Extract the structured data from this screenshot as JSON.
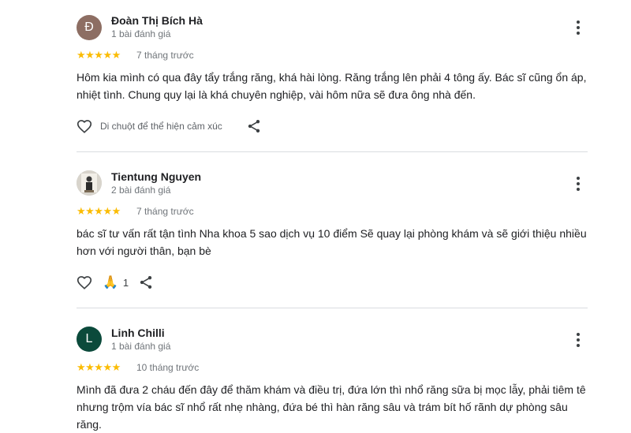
{
  "reviews": [
    {
      "avatar_letter": "Đ",
      "avatar_color": "#8d6e63",
      "name": "Đoàn Thị Bích Hà",
      "review_count": "1 bài đánh giá",
      "stars": "★★★★★",
      "rating": 5,
      "time": "7 tháng trước",
      "text": "Hôm kia mình có qua đây tẩy trắng răng, khá hài lòng. Răng trắng lên phải 4 tông ấy. Bác sĩ cũng ổn áp, nhiệt tình. Chung quy lại là khá chuyên nghiệp, vài hôm nữa sẽ đưa ông nhà đến.",
      "react_hint": "Di chuột để thể hiện cảm xúc"
    },
    {
      "avatar_letter": "",
      "avatar_color": "#cfcfcf",
      "name": "Tientung Nguyen",
      "review_count": "2 bài đánh giá",
      "stars": "★★★★★",
      "rating": 5,
      "time": "7 tháng trước",
      "text": "bác sĩ tư vấn rất tận tình Nha khoa 5 sao dịch vụ 10 điểm Sẽ quay lại phòng khám và sẽ giới thiệu nhiều hơn với người thân, bạn bè",
      "reaction_emoji": "🙏",
      "reaction_count": "1"
    },
    {
      "avatar_letter": "L",
      "avatar_color": "#0b4a3b",
      "name": "Linh Chilli",
      "review_count": "1 bài đánh giá",
      "stars": "★★★★★",
      "rating": 5,
      "time": "10 tháng trước",
      "text": "Mình đã đưa 2 cháu đến đây để thăm khám và điều trị, đứa lớn thì nhổ răng sữa bị mọc lẫy, phải tiêm tê nhưng trộm vía bác sĩ nhổ rất nhẹ nhàng, đứa bé thì hàn răng sâu và trám bít hố rãnh dự phòng sâu răng."
    }
  ],
  "colors": {
    "star": "#fbbc04",
    "meta_text": "#70757a",
    "divider": "#dadce0"
  },
  "icons": {
    "heart": "heart-icon",
    "share": "share-icon",
    "more": "more-vert-icon"
  }
}
